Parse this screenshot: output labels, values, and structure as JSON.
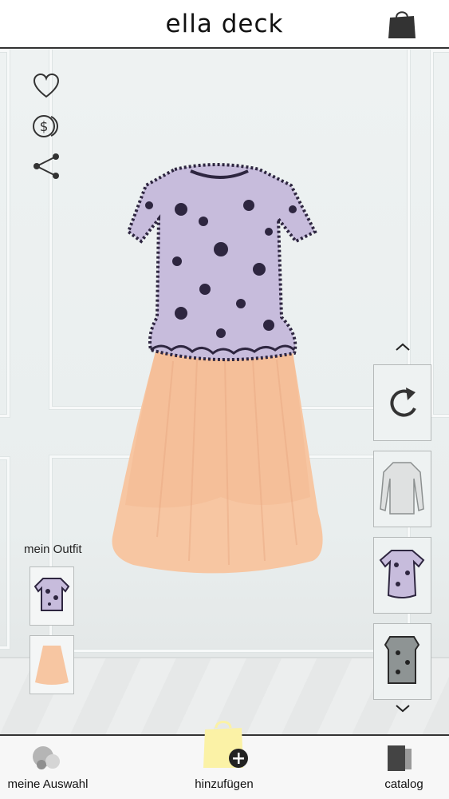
{
  "header": {
    "title": "ella deck",
    "bag_icon": "shopping-bag-icon"
  },
  "side_actions": [
    {
      "icon": "heart-icon"
    },
    {
      "icon": "dollar-coin-icon"
    },
    {
      "icon": "share-icon"
    }
  ],
  "my_outfit": {
    "label": "mein Outfit",
    "items": [
      {
        "icon": "lace-top-thumbnail"
      },
      {
        "icon": "tulle-skirt-thumbnail"
      }
    ]
  },
  "catalog_rail": {
    "up_icon": "chevron-up-icon",
    "down_icon": "chevron-down-icon",
    "refresh_icon": "refresh-icon",
    "items": [
      {
        "icon": "grey-lace-longsleeve-thumbnail"
      },
      {
        "icon": "lavender-lace-top-thumbnail"
      },
      {
        "icon": "black-lace-sleeveless-thumbnail"
      }
    ]
  },
  "bottom_nav": {
    "my_selection": {
      "label": "meine Auswahl",
      "icon": "circles-icon"
    },
    "add": {
      "label": "hinzufügen",
      "icon": "add-bag-icon"
    },
    "catalog": {
      "label": "catalog",
      "icon": "catalog-cards-icon"
    }
  },
  "colors": {
    "top": "#c7bcdc",
    "lace": "#2e2640",
    "skirt": "#f7c6a2",
    "accent_yellow": "#fbf2a6",
    "dark": "#222222"
  }
}
